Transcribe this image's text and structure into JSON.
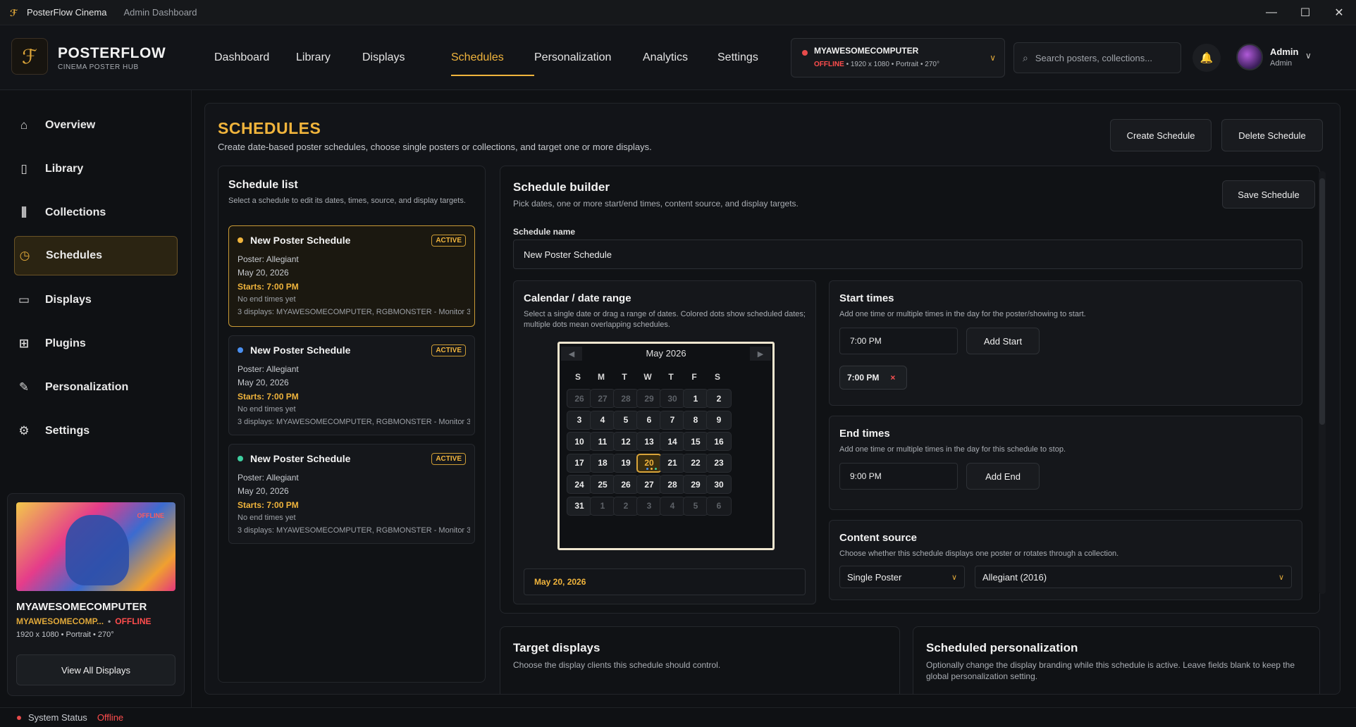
{
  "window": {
    "app_name": "PosterFlow Cinema",
    "subtitle": "Admin Dashboard",
    "controls": [
      "—",
      "☐",
      "✕"
    ]
  },
  "brand": {
    "logo": "ℱ",
    "title": "POSTERFLOW",
    "subtitle": "CINEMA POSTER HUB"
  },
  "nav": {
    "items": [
      "Dashboard",
      "Library",
      "Displays",
      "Schedules",
      "Personalization",
      "Analytics",
      "Settings"
    ],
    "active": "Schedules"
  },
  "device_selector": {
    "name": "MYAWESOMECOMPUTER",
    "status": "OFFLINE",
    "resolution": "1920 x 1080",
    "orientation": "Portrait",
    "rotation": "270°",
    "status_color": "#e84b4b"
  },
  "search": {
    "placeholder": "Search posters, collections..."
  },
  "user": {
    "name": "Admin",
    "role": "Admin"
  },
  "sidebar": {
    "items": [
      {
        "label": "Overview",
        "icon": "home-icon"
      },
      {
        "label": "Library",
        "icon": "book-icon"
      },
      {
        "label": "Collections",
        "icon": "collections-icon"
      },
      {
        "label": "Schedules",
        "icon": "clock-icon"
      },
      {
        "label": "Displays",
        "icon": "monitor-icon"
      },
      {
        "label": "Plugins",
        "icon": "plugin-icon"
      },
      {
        "label": "Personalization",
        "icon": "edit-icon"
      },
      {
        "label": "Settings",
        "icon": "gear-icon"
      }
    ],
    "active": "Schedules",
    "device_card": {
      "poster_overlay": "OFFLINE",
      "name": "MYAWESOMECOMPUTER",
      "short_name": "MYAWESOMECOMP...",
      "status": "OFFLINE",
      "meta": "1920 x 1080  •  Portrait  •  270°",
      "button": "View All Displays"
    }
  },
  "status_bar": {
    "label": "System Status",
    "value": "Offline"
  },
  "page": {
    "title": "SCHEDULES",
    "subtitle": "Create date-based poster schedules, choose single posters or collections, and target one or more displays.",
    "create_button": "Create Schedule",
    "delete_button": "Delete Schedule"
  },
  "schedule_list": {
    "title": "Schedule list",
    "description": "Select a schedule to edit its dates, times, source, and display targets.",
    "items": [
      {
        "name": "New Poster Schedule",
        "badge": "ACTIVE",
        "poster": "Poster: Allegiant",
        "date": "May 20, 2026",
        "starts": "Starts: 7:00 PM",
        "ends": "No end times yet",
        "displays": "3 displays: MYAWESOMECOMPUTER, RGBMONSTER - Monitor 3...",
        "dot_color": "#f0b43c"
      },
      {
        "name": "New Poster Schedule",
        "badge": "ACTIVE",
        "poster": "Poster: Allegiant",
        "date": "May 20, 2026",
        "starts": "Starts: 7:00 PM",
        "ends": "No end times yet",
        "displays": "3 displays: MYAWESOMECOMPUTER, RGBMONSTER - Monitor 3...",
        "dot_color": "#4a8ff0"
      },
      {
        "name": "New Poster Schedule",
        "badge": "ACTIVE",
        "poster": "Poster: Allegiant",
        "date": "May 20, 2026",
        "starts": "Starts: 7:00 PM",
        "ends": "No end times yet",
        "displays": "3 displays: MYAWESOMECOMPUTER, RGBMONSTER - Monitor 3...",
        "dot_color": "#3ecfa0"
      }
    ]
  },
  "builder": {
    "title": "Schedule builder",
    "description": "Pick dates, one or more start/end times, content source, and display targets.",
    "save_button": "Save Schedule",
    "name_label": "Schedule name",
    "name_value": "New Poster Schedule",
    "calendar": {
      "title": "Calendar / date range",
      "description": "Select a single date or drag a range of dates. Colored dots show scheduled dates; multiple dots mean overlapping schedules.",
      "month": "May 2026",
      "prev": "◀",
      "next": "▶",
      "weekdays": [
        "S",
        "M",
        "T",
        "W",
        "T",
        "F",
        "S"
      ],
      "days": [
        "26",
        "27",
        "28",
        "29",
        "30",
        "1",
        "2",
        "3",
        "4",
        "5",
        "6",
        "7",
        "8",
        "9",
        "10",
        "11",
        "12",
        "13",
        "14",
        "15",
        "16",
        "17",
        "18",
        "19",
        "20",
        "21",
        "22",
        "23",
        "24",
        "25",
        "26",
        "27",
        "28",
        "29",
        "30",
        "31",
        "1",
        "2",
        "3",
        "4",
        "5",
        "6"
      ],
      "muted_indices": [
        0,
        1,
        2,
        3,
        4,
        36,
        37,
        38,
        39,
        40,
        41
      ],
      "selected_index": 24,
      "selected_dots": [
        "#4a8ff0",
        "#f0b43c",
        "#3ecfa0"
      ],
      "range_value": "May 20, 2026"
    },
    "start_times": {
      "title": "Start times",
      "description": "Add one time or multiple times in the day for the poster/showing to start.",
      "input_value": "7:00 PM",
      "add_button": "Add Start",
      "chips": [
        {
          "label": "7:00 PM",
          "remove": "×"
        }
      ]
    },
    "end_times": {
      "title": "End times",
      "description": "Add one time or multiple times in the day for this schedule to stop.",
      "input_value": "9:00 PM",
      "add_button": "Add End"
    },
    "content_source": {
      "title": "Content source",
      "description": "Choose whether this schedule displays one poster or rotates through a collection.",
      "type_value": "Single Poster",
      "item_value": "Allegiant (2016)"
    }
  },
  "target_displays": {
    "title": "Target displays",
    "description": "Choose the display clients this schedule should control."
  },
  "scheduled_personalization": {
    "title": "Scheduled personalization",
    "description": "Optionally change the display branding while this schedule is active. Leave fields blank to keep the global personalization setting."
  },
  "colors": {
    "accent": "#f0b43c",
    "offline": "#ff4d4d",
    "background": "#0f1114"
  }
}
